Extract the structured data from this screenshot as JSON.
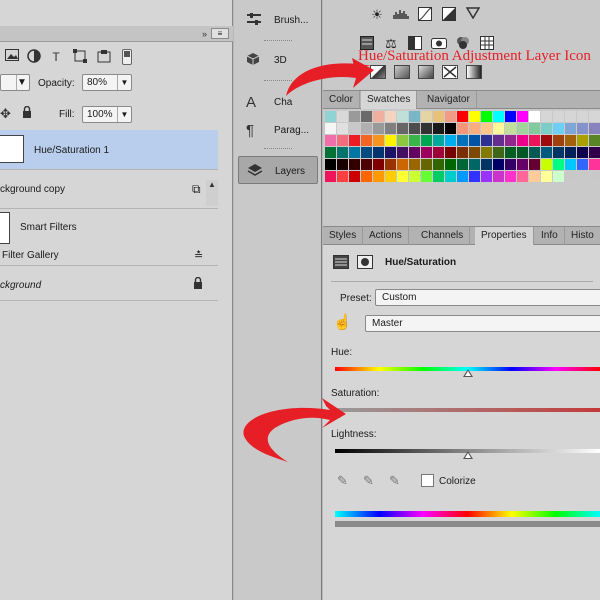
{
  "layers_panel": {
    "collapse_glyph": "»",
    "menu_glyph": "≡",
    "filter_icons": [
      "image-filter-icon",
      "adjustment-filter-icon",
      "type-filter-icon",
      "shape-filter-icon",
      "smart-object-filter-icon"
    ],
    "type_glyph": "T",
    "blend_mode": "",
    "opacity_label": "Opacity:",
    "opacity_value": "80%",
    "fill_label": "Fill:",
    "fill_value": "100%",
    "layers": [
      {
        "name": "Hue/Saturation 1",
        "active": true
      },
      {
        "name": "ckground copy",
        "active": false
      },
      {
        "name": "Smart Filters",
        "active": false
      },
      {
        "name": "Filter Gallery",
        "active": false
      },
      {
        "name": "ckground",
        "active": false
      }
    ]
  },
  "dock": {
    "items": [
      {
        "label": "Brush...",
        "icon": "brush-icon"
      },
      {
        "label": "3D",
        "icon": "cube-icon"
      },
      {
        "label": "Cha",
        "icon": "character-icon",
        "glyph": "A"
      },
      {
        "label": "Parag...",
        "icon": "paragraph-icon",
        "glyph": "¶"
      },
      {
        "label": "Layers",
        "icon": "layers-icon",
        "active": true
      }
    ]
  },
  "adjustments": {
    "annotation": "Hue/Saturation Adjustment Layer Icon"
  },
  "swatches_panel": {
    "tabs": [
      "Color",
      "Swatches",
      "Navigator"
    ],
    "active_tab": "Swatches",
    "rows": [
      [
        "#8fd3d3",
        "#d9d9d9",
        "#9a9a9a",
        "#6b6b6b",
        "#f0b0a0",
        "#f6d3bf",
        "#bfe0d8",
        "#79b6c8",
        "#e5d5a5",
        "#e9c27a",
        "#f29b85",
        "#ff0000",
        "#ffff00",
        "#00ff00",
        "#00ffff",
        "#0000ff",
        "#ff00ff",
        "#ffffff",
        "#d6d6d6",
        "#d6d6d6",
        "#d6d6d6",
        "#d6d6d6",
        "#d6d6d6",
        "#d6d6d6"
      ],
      [
        "#f5f5f5",
        "#e0e0e0",
        "#c8c8c8",
        "#b0b0b0",
        "#999999",
        "#808080",
        "#666666",
        "#4d4d4d",
        "#333333",
        "#1a1a1a",
        "#000000",
        "#f7977a",
        "#f9ad81",
        "#fdc68a",
        "#fff79a",
        "#c4df9b",
        "#a2d39c",
        "#82ca9d",
        "#7bcdc8",
        "#6ecff6",
        "#7ea7d8",
        "#8493ca",
        "#8882be",
        "#a187be"
      ],
      [
        "#f06eaa",
        "#f26d7d",
        "#ed1c24",
        "#f26522",
        "#f7941d",
        "#fff200",
        "#8dc73f",
        "#39b54a",
        "#00a651",
        "#00a99d",
        "#00aeef",
        "#0072bc",
        "#0054a6",
        "#2e3192",
        "#662d91",
        "#92278f",
        "#ec008c",
        "#ed145b",
        "#9e0b0f",
        "#a0410d",
        "#a3620a",
        "#aba000",
        "#598527",
        "#1a7b30"
      ],
      [
        "#007236",
        "#00746b",
        "#0076a3",
        "#004b80",
        "#003471",
        "#1b1464",
        "#440e62",
        "#630460",
        "#9e005d",
        "#9e0039",
        "#790000",
        "#7b2e00",
        "#7d4900",
        "#827b00",
        "#406618",
        "#005e20",
        "#005826",
        "#005952",
        "#005b7f",
        "#003663",
        "#002157",
        "#0d004c",
        "#32004b",
        "#4b0049"
      ],
      [
        "#000000",
        "#1a0000",
        "#330000",
        "#4d0000",
        "#800000",
        "#993300",
        "#cc6600",
        "#996600",
        "#666600",
        "#336600",
        "#006600",
        "#006633",
        "#006666",
        "#003366",
        "#000066",
        "#330066",
        "#660066",
        "#660033",
        "#c8ff00",
        "#00ff80",
        "#00c8ff",
        "#3366ff",
        "#ff3399",
        "#ff0066"
      ],
      [
        "#ed145b",
        "#ff4040",
        "#cc0000",
        "#ff6600",
        "#ff9900",
        "#ffcc00",
        "#ffff33",
        "#ccff33",
        "#66ff33",
        "#00cc66",
        "#00cccc",
        "#0099ff",
        "#3333ff",
        "#9933ff",
        "#cc33cc",
        "#ff33cc",
        "#ff6699",
        "#ffcc99",
        "#ffff99",
        "#ccffcc",
        "#c8c8c8",
        "#c8c8c8",
        "#c8c8c8",
        "#c8c8c8"
      ]
    ]
  },
  "properties_panel": {
    "tabs": [
      "Styles",
      "Actions",
      "Channels",
      "Properties",
      "Info",
      "Histo"
    ],
    "active_tab": "Properties",
    "title": "Hue/Saturation",
    "preset_label": "Preset:",
    "preset_value": "Custom",
    "channel_value": "Master",
    "hue_label": "Hue:",
    "saturation_label": "Saturation:",
    "lightness_label": "Lightness:",
    "colorize_label": "Colorize",
    "hue_level": 0.5,
    "saturation_level": 0.0,
    "lightness_level": 0.5,
    "colorize_checked": false
  },
  "colors": {
    "annotation_red": "#e61f26",
    "active_layer_bg": "#b9cdec"
  }
}
